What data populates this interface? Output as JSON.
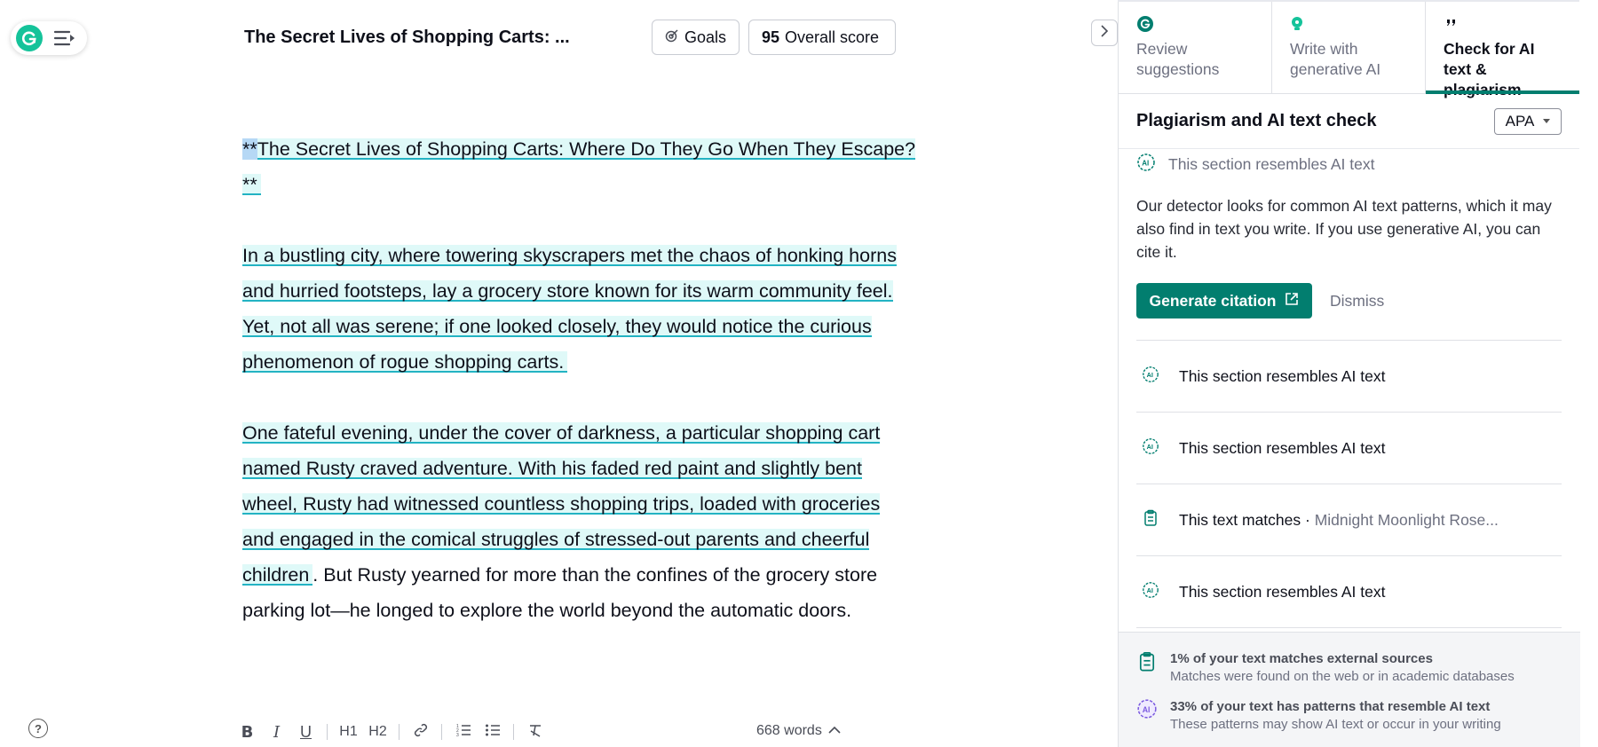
{
  "header": {
    "doc_title": "The Secret Lives of Shopping Carts: ...",
    "goals_label": "Goals",
    "score_value": "95",
    "score_label": "Overall score"
  },
  "editor": {
    "title_sel": "**",
    "title_rest": "The Secret Lives of Shopping Carts: Where Do They Go When They Escape?**",
    "p1": "In a bustling city, where towering skyscrapers met the chaos of honking horns and hurried footsteps, lay a grocery store known for its warm community feel. Yet, not all was serene; if one looked closely, they would notice the curious phenomenon of rogue shopping carts.",
    "p2_hl": "One fateful evening, under the cover of darkness, a particular shopping cart named Rusty craved adventure. With his faded red paint and slightly bent wheel, Rusty had witnessed countless shopping trips, loaded with groceries and engaged in the comical struggles of stressed-out parents and cheerful children",
    "p2_rest": ". But Rusty yearned for more than the confines of the grocery store parking lot—he longed to explore the world beyond the automatic doors."
  },
  "toolbar": {
    "bold": "B",
    "italic": "I",
    "underline": "U",
    "h1": "H1",
    "h2": "H2",
    "word_count": "668 words"
  },
  "panel": {
    "tabs": [
      {
        "label": "Review suggestions",
        "icon": "grammarly-icon"
      },
      {
        "label": "Write with generative AI",
        "icon": "bulb-icon"
      },
      {
        "label": "Check for AI text & plagiarism",
        "icon": "quote-icon"
      }
    ],
    "title": "Plagiarism and AI text check",
    "citation_style": "APA",
    "card": {
      "head": "This section resembles AI text",
      "body": "Our detector looks for common AI text patterns, which it may also find in text you write. If you use generative AI, you can cite it.",
      "generate_label": "Generate citation",
      "dismiss_label": "Dismiss"
    },
    "items": [
      {
        "label": "This section resembles AI text",
        "icon": "ai-brain-icon"
      },
      {
        "label": "This section resembles AI text",
        "icon": "ai-brain-icon"
      },
      {
        "label": "This text matches · ",
        "source": "Midnight Moonlight Rose...",
        "icon": "clipboard-icon"
      },
      {
        "label": "This section resembles AI text",
        "icon": "ai-brain-icon"
      }
    ],
    "summary": [
      {
        "title": "1% of your text matches external sources",
        "sub": "Matches were found on the web or in academic databases"
      },
      {
        "title": "33% of your text has patterns that resemble AI text",
        "sub": "These patterns may show AI text or occur in your writing"
      }
    ]
  },
  "colors": {
    "brand_green": "#15c39a",
    "accent_teal": "#027e6f",
    "highlight": "#dff9f8",
    "underline": "#23b3c3"
  }
}
